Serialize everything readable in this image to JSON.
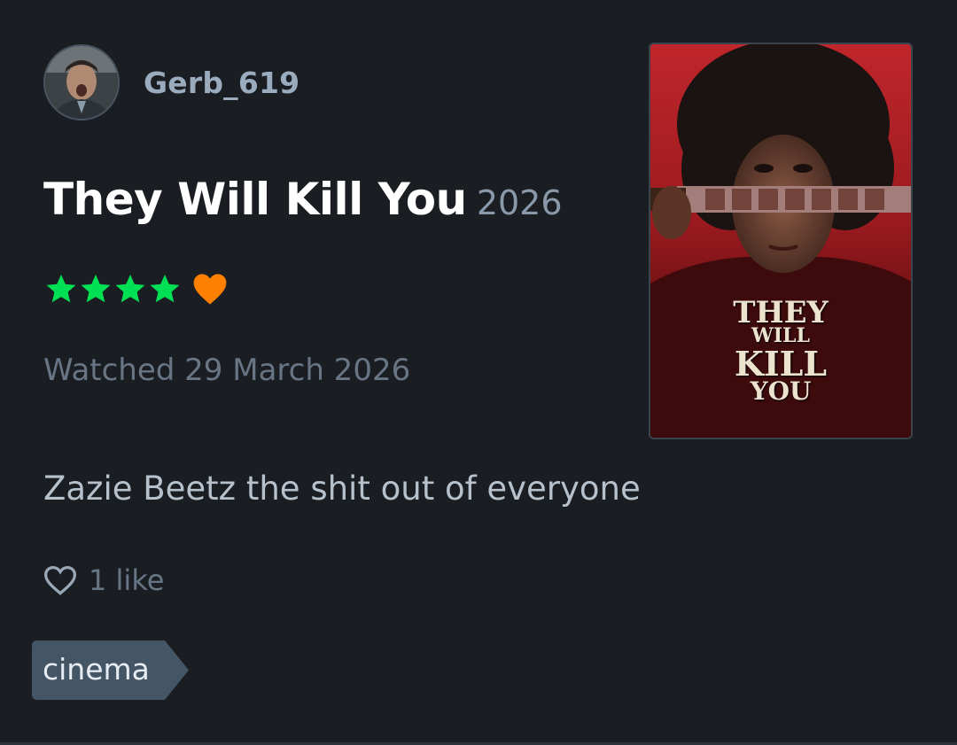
{
  "review": {
    "username": "Gerb_619",
    "film_title": "They Will Kill You",
    "film_year": "2026",
    "rating": {
      "stars": 4,
      "max_stars": 5,
      "liked": true,
      "star_color": "#00e054",
      "heart_color": "#ff8000"
    },
    "watched_text": "Watched 29 March 2026",
    "text": "Zazie Beetz the shit out of everyone",
    "likes_label": "1 like",
    "tags": [
      "cinema"
    ]
  },
  "poster": {
    "line1": "THEY",
    "line2": "WILL",
    "line3": "KILL",
    "line4": "YOU"
  },
  "icons": {
    "avatar": "avatar",
    "star": "star-icon",
    "like_heart": "heart-icon",
    "likes_heart": "heart-outline-icon"
  }
}
